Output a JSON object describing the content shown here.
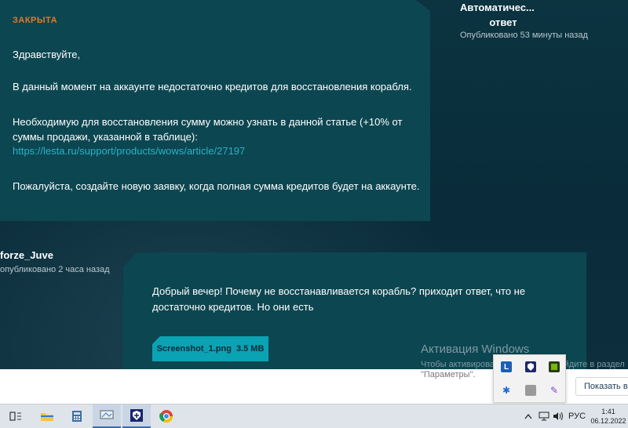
{
  "ticket": {
    "status": "ЗАКРЫТА",
    "greeting": "Здравствуйте,",
    "line1": "В данный момент на аккаунте недостаточно кредитов для восстановления корабля.",
    "line2a": "Необходимую для восстановления сумму можно узнать в данной статье (+10% от",
    "line2b": "суммы продажи, указанной в таблице):",
    "link": "https://lesta.ru/support/products/wows/article/27197",
    "line3": "Пожалуйста, создайте новую заявку, когда полная сумма кредитов будет на аккаунте."
  },
  "auto": {
    "name_line1": "Автоматичес...",
    "name_line2": "ответ",
    "time": "Опубликовано 53 минуты назад"
  },
  "user": {
    "name": "forze_Juve",
    "time": "опубликовано 2 часа назад"
  },
  "reply": {
    "text": "Добрый вечер! Почему не восстанавливается корабль? приходит ответ, что не достаточно кредитов. Но они есть",
    "attachment_name": "Screenshot_1.png",
    "attachment_size": "3.5 MB"
  },
  "activation": {
    "title": "Активация Windows",
    "sub1": "Чтобы активировать Windows, перейдите в раздел",
    "sub2": "\"Параметры\"."
  },
  "notification": {
    "show_all": "Показать все"
  },
  "taskbar": {
    "lang": "РУС",
    "time": "1:41",
    "date": "06.12.2022"
  },
  "colors": {
    "accent": "#0aa3b3",
    "status": "#e07b27",
    "panel": "#0c4651"
  }
}
